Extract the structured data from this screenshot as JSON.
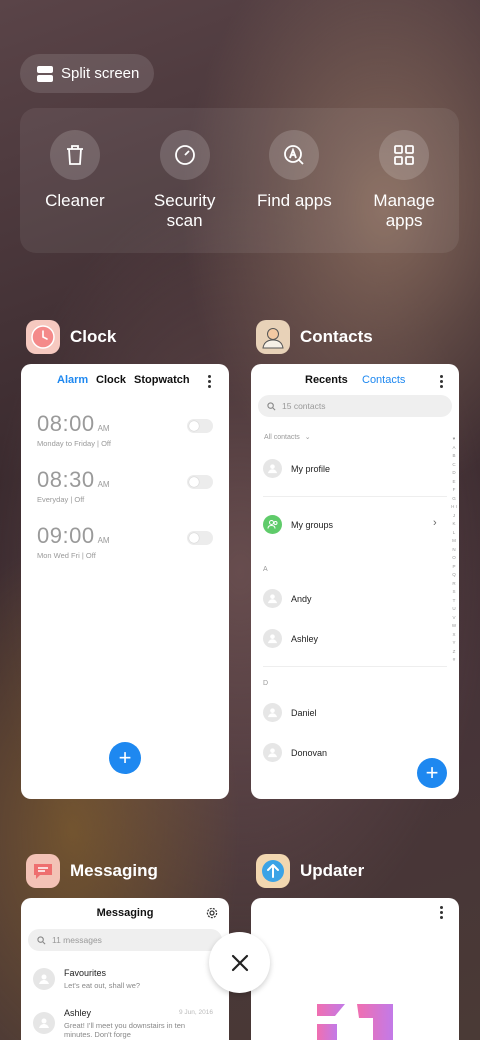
{
  "split_screen": {
    "label": "Split screen"
  },
  "tools": [
    {
      "label": "Cleaner",
      "icon": "trash-icon"
    },
    {
      "label": "Security\nscan",
      "icon": "security-scan-icon"
    },
    {
      "label": "Find apps",
      "icon": "find-apps-icon"
    },
    {
      "label": "Manage\napps",
      "icon": "grid-icon"
    }
  ],
  "apps": {
    "clock": {
      "name": "Clock",
      "tabs": [
        "Alarm",
        "Clock",
        "Stopwatch"
      ],
      "alarms": [
        {
          "time": "08:00",
          "ampm": "AM",
          "days": "Monday to Friday",
          "state": "Off"
        },
        {
          "time": "08:30",
          "ampm": "AM",
          "days": "Everyday",
          "state": "Off"
        },
        {
          "time": "09:00",
          "ampm": "AM",
          "days": "Mon Wed Fri",
          "state": "Off"
        }
      ],
      "fab": "+"
    },
    "contacts": {
      "name": "Contacts",
      "tabs": [
        "Recents",
        "Contacts"
      ],
      "search_placeholder": "15 contacts",
      "filter": "All contacts",
      "my_profile": "My profile",
      "my_groups": "My groups",
      "sections": [
        {
          "letter": "A",
          "names": [
            "Andy",
            "Ashley"
          ]
        },
        {
          "letter": "D",
          "names": [
            "Daniel",
            "Donovan"
          ]
        }
      ],
      "index_letters": "♥ A B C D E F G H I J K L M N O P Q R S T U V W X Y Z #",
      "fab": "+"
    },
    "messaging": {
      "name": "Messaging",
      "title": "Messaging",
      "search_placeholder": "11 messages",
      "messages": [
        {
          "sender": "Favourites",
          "preview": "Let's eat out, shall we?",
          "date": ""
        },
        {
          "sender": "Ashley",
          "preview": "Great! I'll meet you downstairs in ten minutes. Don't forge",
          "date": "9 Jun, 2016"
        }
      ]
    },
    "updater": {
      "name": "Updater"
    }
  },
  "colors": {
    "accent": "#1e88f0",
    "updater_logo_start": "#f06fb0",
    "updater_logo_end": "#c27ae8"
  }
}
